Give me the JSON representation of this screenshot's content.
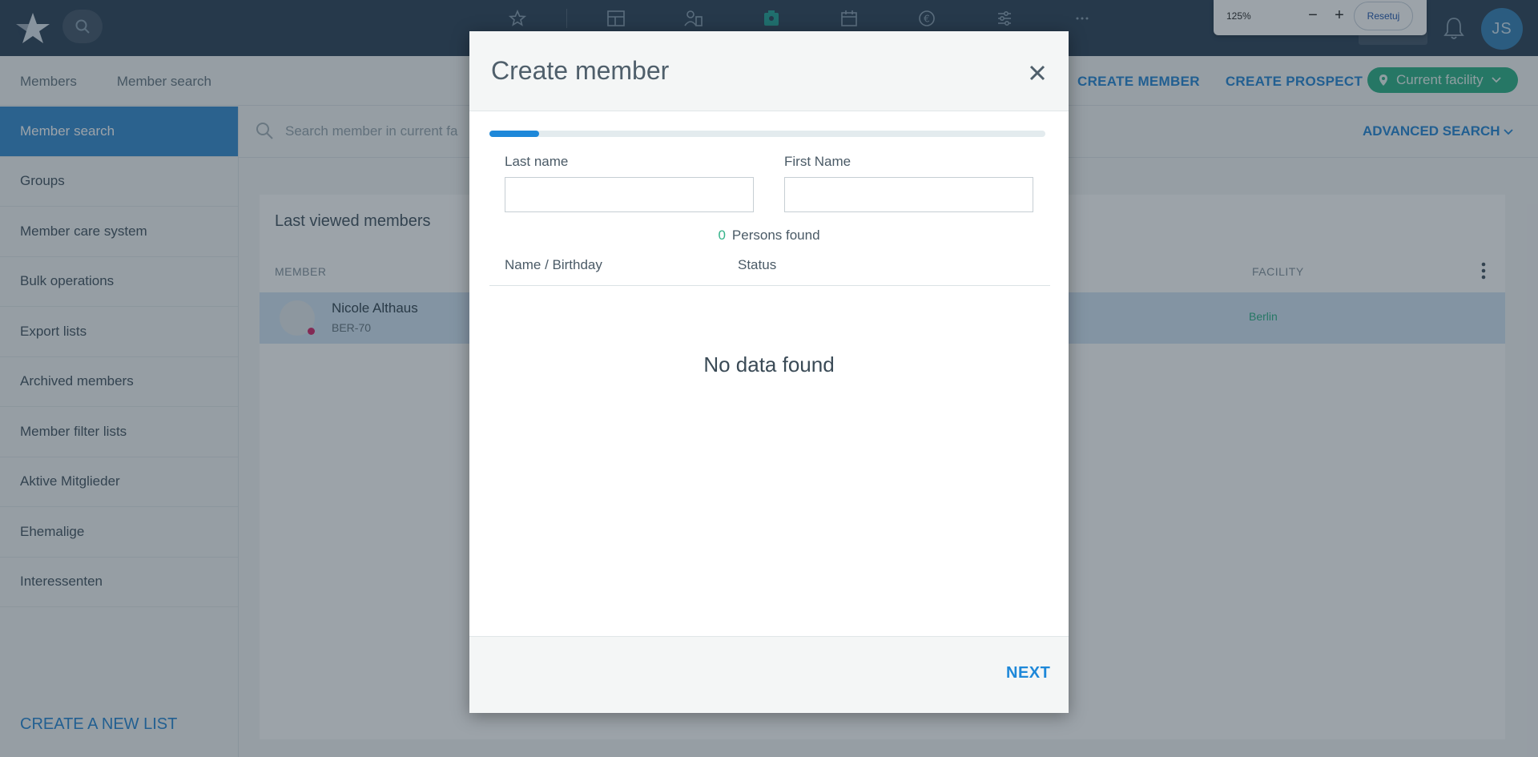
{
  "zoom": {
    "level": "125%",
    "minus": "−",
    "plus": "+",
    "reset_label": "Resetuj"
  },
  "topbar": {
    "user_initials": "JS"
  },
  "breadcrumb": {
    "root": "Members",
    "current": "Member search"
  },
  "header_actions": {
    "create_member": "CREATE MEMBER",
    "create_prospect": "CREATE PROSPECT",
    "facility": "Current facility"
  },
  "sidebar": {
    "items": [
      {
        "label": "Member search"
      },
      {
        "label": "Groups"
      },
      {
        "label": "Member care system"
      },
      {
        "label": "Bulk operations"
      },
      {
        "label": "Export lists"
      },
      {
        "label": "Archived members"
      },
      {
        "label": "Member filter lists"
      },
      {
        "label": "Aktive Mitglieder"
      },
      {
        "label": "Ehemalige"
      },
      {
        "label": "Interessenten"
      }
    ],
    "create_list": "CREATE A NEW LIST"
  },
  "search": {
    "placeholder": "Search member in current fa",
    "advanced": "ADVANCED SEARCH"
  },
  "last_viewed": {
    "title": "Last viewed members",
    "col_member": "MEMBER",
    "col_facility": "FACILITY",
    "rows": [
      {
        "name": "Nicole Althaus",
        "id": "BER-70",
        "facility": "Berlin"
      }
    ]
  },
  "modal": {
    "title": "Create member",
    "progress": 0.09,
    "last_name_label": "Last name",
    "last_name_value": "",
    "first_name_label": "First Name",
    "first_name_value": "",
    "found_count": "0",
    "found_label": "Persons found",
    "col_name": "Name / Birthday",
    "col_status": "Status",
    "empty": "No data found",
    "next": "NEXT"
  },
  "colors": {
    "accent": "#1e88d9",
    "topbar": "#34495e",
    "success": "#35b38a",
    "active": "#3d8fd1"
  }
}
